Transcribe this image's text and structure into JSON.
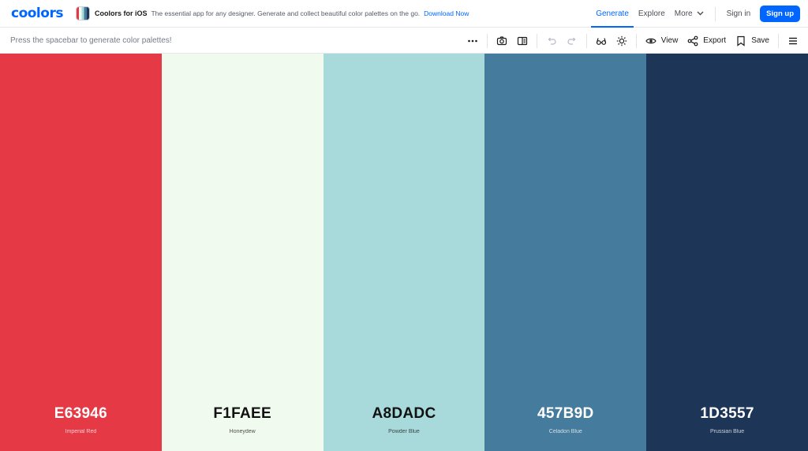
{
  "header": {
    "logo": "coolors",
    "promo": {
      "title": "Coolors for iOS",
      "text": "The essential app for any designer. Generate and collect beautiful color palettes on the go.",
      "link": "Download Now"
    },
    "nav": {
      "generate": "Generate",
      "explore": "Explore",
      "more": "More",
      "signin": "Sign in",
      "signup": "Sign up"
    }
  },
  "toolbar": {
    "hint": "Press the spacebar to generate color palettes!",
    "view_label": "View",
    "export_label": "Export",
    "save_label": "Save"
  },
  "colors": {
    "accent": "#0066ff"
  },
  "palette": [
    {
      "hex": "E63946",
      "name": "Imperial Red",
      "color": "#E63946",
      "text_color": "#ffffff"
    },
    {
      "hex": "F1FAEE",
      "name": "Honeydew",
      "color": "#F1FAEE",
      "text_color": "#111111"
    },
    {
      "hex": "A8DADC",
      "name": "Powder Blue",
      "color": "#A8DADC",
      "text_color": "#111111"
    },
    {
      "hex": "457B9D",
      "name": "Celadon Blue",
      "color": "#457B9D",
      "text_color": "#ffffff"
    },
    {
      "hex": "1D3557",
      "name": "Prussian Blue",
      "color": "#1D3557",
      "text_color": "#ffffff"
    }
  ]
}
